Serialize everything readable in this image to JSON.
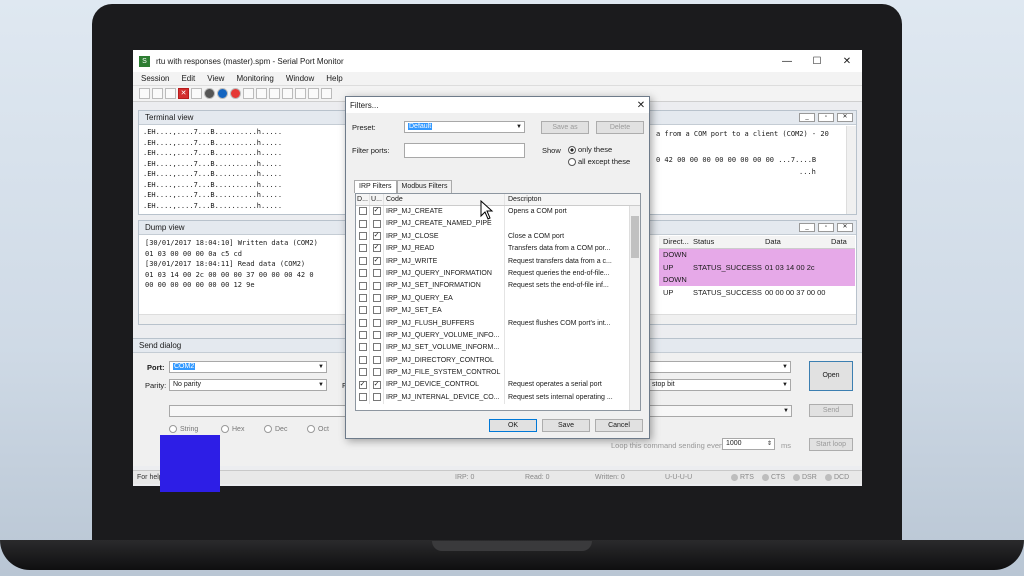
{
  "window": {
    "title": "rtu with responses (master).spm - Serial Port Monitor",
    "app_icon": "green-app-icon",
    "controls": [
      "—",
      "☐",
      "✕"
    ]
  },
  "menu": [
    "Session",
    "Edit",
    "View",
    "Monitoring",
    "Window",
    "Help"
  ],
  "terminal": {
    "title": "Terminal view",
    "lines": [
      ".EH....,....7...B..........h.....",
      ".EH....,....7...B..........h.....",
      ".EH....,....7...B..........h.....",
      ".EH....,....7...B..........h.....",
      ".EH....,....7...B..........h.....",
      ".EH....,....7...B..........h.....",
      ".EH....,....7...B..........h.....",
      ".EH....,....7...B..........h....."
    ],
    "right_text1": "a from a COM port to a client (COM2) - 20",
    "right_text2": "0 42 00 00 00 00 00 00 00 00     ...7....B",
    "right_text3": "...h"
  },
  "dump": {
    "title": "Dump view",
    "lines": [
      "[30/01/2017 18:04:10] Written data (COM2)",
      "    01 03 00 00 00 0a c5 cd",
      "[30/01/2017 18:04:11] Read data (COM2)",
      "    01 03 14 00 2c 00 00 00 37 00 00 00 42 0",
      "    00 00 00 00 00 00 00 12 9e"
    ],
    "columns": [
      "Direct...",
      "Status",
      "Data",
      "Data"
    ],
    "rows": [
      {
        "dir": "DOWN",
        "status": "",
        "data": "",
        "pink": true
      },
      {
        "dir": "UP",
        "status": "STATUS_SUCCESS",
        "data": "01 03 14 00 2c",
        "pink": true
      },
      {
        "dir": "DOWN",
        "status": "",
        "data": "",
        "pink": true
      },
      {
        "dir": "UP",
        "status": "STATUS_SUCCESS",
        "data": "00 00 00 37 00 00",
        "pink": false
      }
    ]
  },
  "send": {
    "title": "Send dialog",
    "port_label": "Port:",
    "port_value": "COM2",
    "parity_label": "Parity:",
    "parity_value": "No parity",
    "f_label": "F",
    "stop_value": "stop bit",
    "open_label": "Open",
    "send_label": "Send",
    "formats": [
      "String",
      "Hex",
      "Dec",
      "Oct"
    ],
    "loop_label": "Loop this command sending every",
    "loop_value": "1000",
    "loop_unit": "ms",
    "start_loop": "Start loop"
  },
  "status": {
    "help": "For help",
    "irp": "IRP: 0",
    "read": "Read: 0",
    "written": "Written: 0",
    "mode": "U-U-U-U",
    "leds": [
      "RTS",
      "CTS",
      "DSR",
      "DCD"
    ]
  },
  "filters": {
    "title": "Filters...",
    "preset_label": "Preset:",
    "preset_value": "Default",
    "save_as": "Save as",
    "delete": "Delete",
    "filter_ports_label": "Filter ports:",
    "show_label": "Show",
    "show_only": "only these",
    "show_except": "all except these",
    "tabs": [
      "IRP Filters",
      "Modbus Filters"
    ],
    "headers": [
      "D...",
      "U...",
      "Code",
      "Descripton"
    ],
    "rows": [
      {
        "d": false,
        "u": true,
        "code": "IRP_MJ_CREATE",
        "desc": "Opens a COM port"
      },
      {
        "d": false,
        "u": false,
        "code": "IRP_MJ_CREATE_NAMED_PIPE",
        "desc": ""
      },
      {
        "d": false,
        "u": true,
        "code": "IRP_MJ_CLOSE",
        "desc": "Close a COM port"
      },
      {
        "d": false,
        "u": true,
        "code": "IRP_MJ_READ",
        "desc": "Transfers data from a COM por..."
      },
      {
        "d": false,
        "u": true,
        "code": "IRP_MJ_WRITE",
        "desc": "Request transfers data from a c..."
      },
      {
        "d": false,
        "u": false,
        "code": "IRP_MJ_QUERY_INFORMATION",
        "desc": "Request queries the end-of-file..."
      },
      {
        "d": false,
        "u": false,
        "code": "IRP_MJ_SET_INFORMATION",
        "desc": "Request sets the end-of-file inf..."
      },
      {
        "d": false,
        "u": false,
        "code": "IRP_MJ_QUERY_EA",
        "desc": ""
      },
      {
        "d": false,
        "u": false,
        "code": "IRP_MJ_SET_EA",
        "desc": ""
      },
      {
        "d": false,
        "u": false,
        "code": "IRP_MJ_FLUSH_BUFFERS",
        "desc": "Request flushes COM port's int..."
      },
      {
        "d": false,
        "u": false,
        "code": "IRP_MJ_QUERY_VOLUME_INFO...",
        "desc": ""
      },
      {
        "d": false,
        "u": false,
        "code": "IRP_MJ_SET_VOLUME_INFORM...",
        "desc": ""
      },
      {
        "d": false,
        "u": false,
        "code": "IRP_MJ_DIRECTORY_CONTROL",
        "desc": ""
      },
      {
        "d": false,
        "u": false,
        "code": "IRP_MJ_FILE_SYSTEM_CONTROL",
        "desc": ""
      },
      {
        "d": true,
        "u": true,
        "code": "IRP_MJ_DEVICE_CONTROL",
        "desc": "Request operates a serial port"
      },
      {
        "d": false,
        "u": false,
        "code": "IRP_MJ_INTERNAL_DEVICE_CO...",
        "desc": "Request sets internal operating ..."
      }
    ],
    "ok": "OK",
    "save": "Save",
    "cancel": "Cancel"
  },
  "colors": {
    "pink_row": "#e6a9e8",
    "overlay": "#2d1ee6",
    "selection": "#3399ff"
  }
}
